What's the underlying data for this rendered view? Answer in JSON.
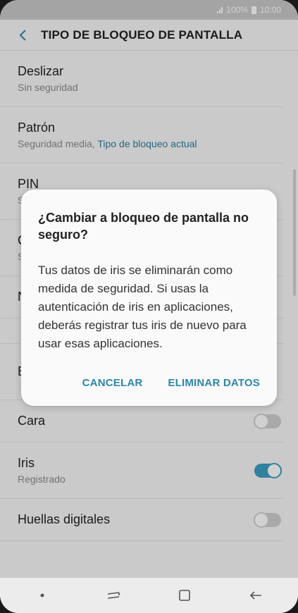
{
  "status_bar": {
    "signal": "signal-icon",
    "battery_text": "100%",
    "time": "10:00"
  },
  "header": {
    "back_icon": "chevron-left-icon",
    "title": "TIPO DE BLOQUEO DE PANTALLA"
  },
  "list": {
    "items": [
      {
        "label": "Deslizar",
        "sub": "Sin seguridad"
      },
      {
        "label": "Patrón",
        "sub_prefix": "Seguridad media, ",
        "sub_accent": "Tipo de bloqueo actual"
      },
      {
        "label": "PIN"
      },
      {
        "label": "Cara",
        "toggle": false
      },
      {
        "label": "Iris",
        "sub": "Registrado",
        "toggle": true
      },
      {
        "label": "Huellas digitales",
        "toggle": false
      }
    ]
  },
  "dialog": {
    "title": "¿Cambiar a bloqueo de pantalla no seguro?",
    "body": "Tus datos de iris se eliminarán como medida de seguridad. Si usas la autenticación de iris en aplicaciones, deberás registrar tus iris de nuevo para usar esas aplicaciones.",
    "cancel": "CANCELAR",
    "confirm": "ELIMINAR DATOS"
  },
  "navbar": {
    "items": [
      "dot-icon",
      "recent-apps-icon",
      "home-icon",
      "back-arrow-icon"
    ]
  },
  "colors": {
    "accent": "#2d86a8",
    "toggle_on": "#3c9fc0"
  }
}
